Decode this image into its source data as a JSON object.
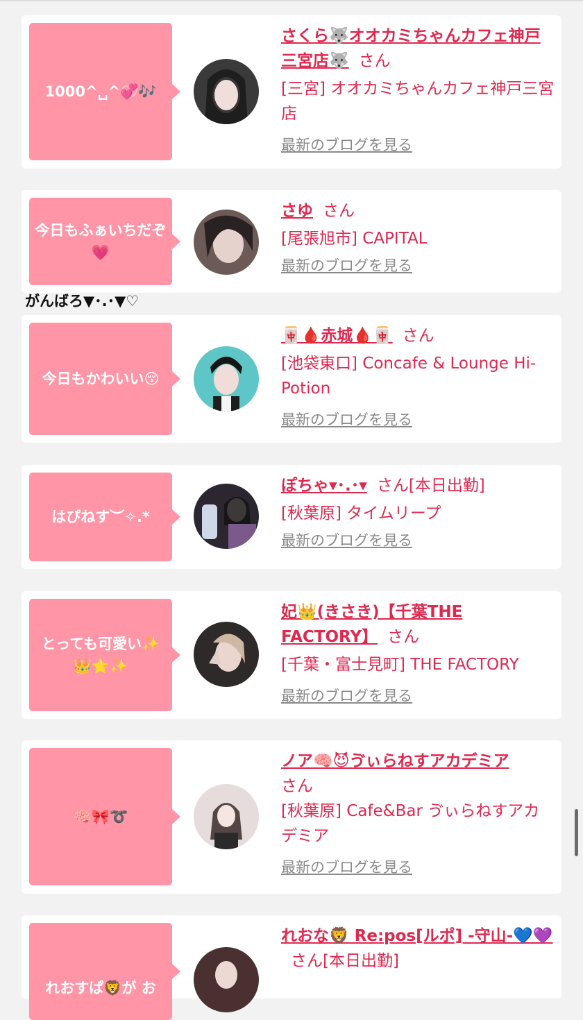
{
  "colors": {
    "accent": "#e0284f",
    "bubble": "#ff95a6",
    "link_gray": "#8a8a8a",
    "background": "#f2f2f2"
  },
  "stray_text": "がんばろ▼･.･▼♡",
  "cards": [
    {
      "message": "1000^␣^💞🎶",
      "name": "さくら🐺オオカミちゃんカフェ神戸三宮店🐺",
      "san": "さん",
      "shop": "[三宮] オオカミちゃんカフェ神戸三宮店",
      "blog_link": "最新のブログを見る",
      "avatar_color": "#3a3a3a"
    },
    {
      "message": "今日もふぁいちだぞ💗",
      "name": "さゆ",
      "san": "さん",
      "shop": "[尾張旭市] CAPITAL",
      "blog_link": "最新のブログを見る",
      "avatar_color": "#6b5a55"
    },
    {
      "message": "今日もかわいい😚",
      "name": "🀄🩸赤城🩸🀄",
      "san": "さん",
      "shop": "[池袋東口] Concafe & Lounge Hi-Potion",
      "blog_link": "最新のブログを見る",
      "avatar_color": "#5fc6c8"
    },
    {
      "message": "はぴねす︶✧.*",
      "name": "ぽちゃ▾･.･▾",
      "san": "さん[本日出勤]",
      "shop": "[秋葉原] タイムリープ",
      "blog_link": "最新のブログを見る",
      "avatar_color": "#2b2630"
    },
    {
      "message": "とっても可愛い✨👑⭐✨",
      "name": "妃👑(きさき)【千葉THE FACTORY】",
      "san": "さん",
      "shop": "[千葉・富士見町] THE FACTORY",
      "blog_link": "最新のブログを見る",
      "avatar_color": "#2f2a2a"
    },
    {
      "message": "🧠🎀➰",
      "name": "ノア🧠😈ゔぃらねすアカデミア",
      "san": "さん",
      "shop": "[秋葉原] Cafe&Bar ゔぃらねすアカデミア",
      "blog_link": "最新のブログを見る",
      "avatar_color": "#e7dcdc"
    },
    {
      "message": "れおすぱ🦁が お",
      "name": "れおな🦁 Re:pos[ルポ] -守山-💙💜",
      "san": "さん[本日出勤]",
      "shop": "",
      "blog_link": "",
      "avatar_color": "#4a3030"
    }
  ]
}
